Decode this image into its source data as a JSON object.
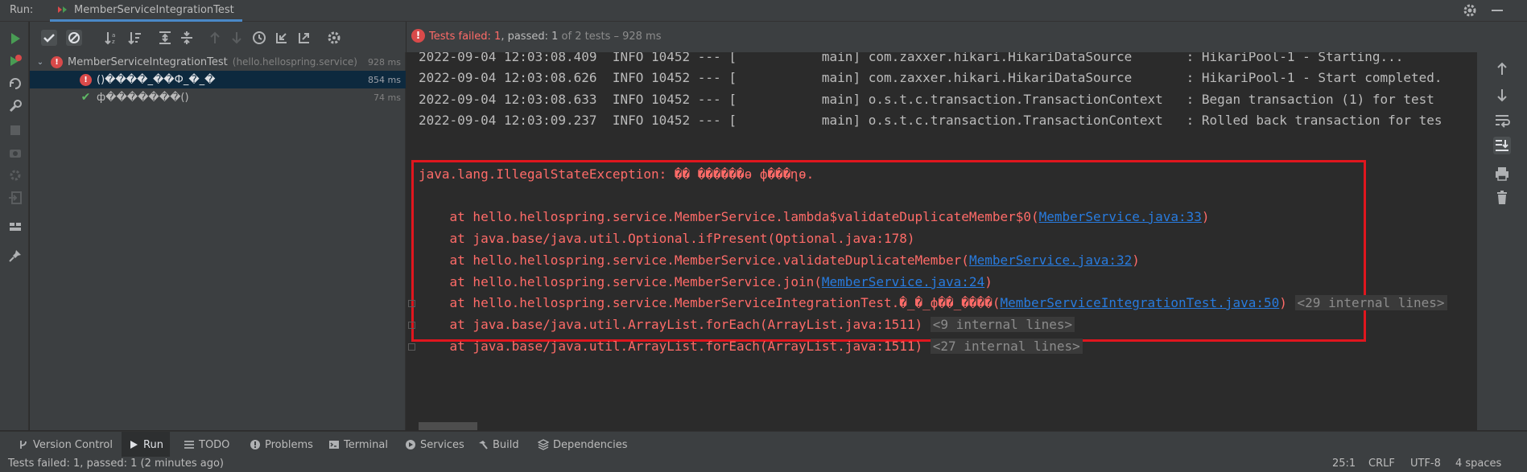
{
  "header": {
    "run_label": "Run:",
    "tab_name": "MemberServiceIntegrationTest"
  },
  "status": {
    "prefix": "Tests failed: ",
    "failed": "1",
    "mid": ", passed: ",
    "passed": "1",
    "suffix": " of 2 tests – 928 ms"
  },
  "tree": {
    "root": {
      "name": "MemberServiceIntegrationTest",
      "package": "(hello.hellospring.service)",
      "duration": "928 ms"
    },
    "items": [
      {
        "name": "()����_��Ф_�_�",
        "duration": "854 ms",
        "status": "failed"
      },
      {
        "name": "ф�������()",
        "duration": "74 ms",
        "status": "passed"
      }
    ]
  },
  "console": {
    "logs": [
      "2022-09-04 12:03:08.409  INFO 10452 --- [           main] com.zaxxer.hikari.HikariDataSource       : HikariPool-1 - Starting...",
      "2022-09-04 12:03:08.626  INFO 10452 --- [           main] com.zaxxer.hikari.HikariDataSource       : HikariPool-1 - Start completed.",
      "2022-09-04 12:03:08.633  INFO 10452 --- [           main] o.s.t.c.transaction.TransactionContext   : Began transaction (1) for test",
      "2022-09-04 12:03:09.237  INFO 10452 --- [           main] o.s.t.c.transaction.TransactionContext   : Rolled back transaction for tes"
    ],
    "exception": "java.lang.IllegalStateException: �� ������ө ф���ղө.",
    "stack": [
      {
        "text": "    at hello.hellospring.service.MemberService.lambda$validateDuplicateMember$0(",
        "link": "MemberService.java:33",
        "end": ")",
        "internal": ""
      },
      {
        "text": "    at java.base/java.util.Optional.ifPresent(Optional.java:178)",
        "link": "",
        "end": "",
        "internal": ""
      },
      {
        "text": "    at hello.hellospring.service.MemberService.validateDuplicateMember(",
        "link": "MemberService.java:32",
        "end": ")",
        "internal": ""
      },
      {
        "text": "    at hello.hellospring.service.MemberService.join(",
        "link": "MemberService.java:24",
        "end": ")",
        "internal": ""
      },
      {
        "text": "    at hello.hellospring.service.MemberServiceIntegrationTest.�_�_ф��_����(",
        "link": "MemberServiceIntegrationTest.java:50",
        "end": ")",
        "internal": "<29 internal lines>"
      },
      {
        "text": "    at java.base/java.util.ArrayList.forEach(ArrayList.java:1511)",
        "link": "",
        "end": "",
        "internal": "<9 internal lines>"
      },
      {
        "text": "    at java.base/java.util.ArrayList.forEach(ArrayList.java:1511)",
        "link": "",
        "end": "",
        "internal": "<27 internal lines>"
      }
    ]
  },
  "bottom_tabs": [
    {
      "label": "Version Control",
      "icon": "branch-icon"
    },
    {
      "label": "Run",
      "icon": "run-icon"
    },
    {
      "label": "TODO",
      "icon": "list-icon"
    },
    {
      "label": "Problems",
      "icon": "info-icon"
    },
    {
      "label": "Terminal",
      "icon": "terminal-icon"
    },
    {
      "label": "Services",
      "icon": "services-icon"
    },
    {
      "label": "Build",
      "icon": "hammer-icon"
    },
    {
      "label": "Dependencies",
      "icon": "layers-icon"
    }
  ],
  "status_bar": {
    "message": "Tests failed: 1, passed: 1 (2 minutes ago)",
    "position": "25:1",
    "line_sep": "CRLF",
    "encoding": "UTF-8",
    "indent": "4 spaces"
  },
  "colors": {
    "error": "#ff6b68",
    "link": "#287bde",
    "highlight_box": "#e0161e",
    "pass": "#5fb865",
    "fail": "#d94a4a"
  }
}
